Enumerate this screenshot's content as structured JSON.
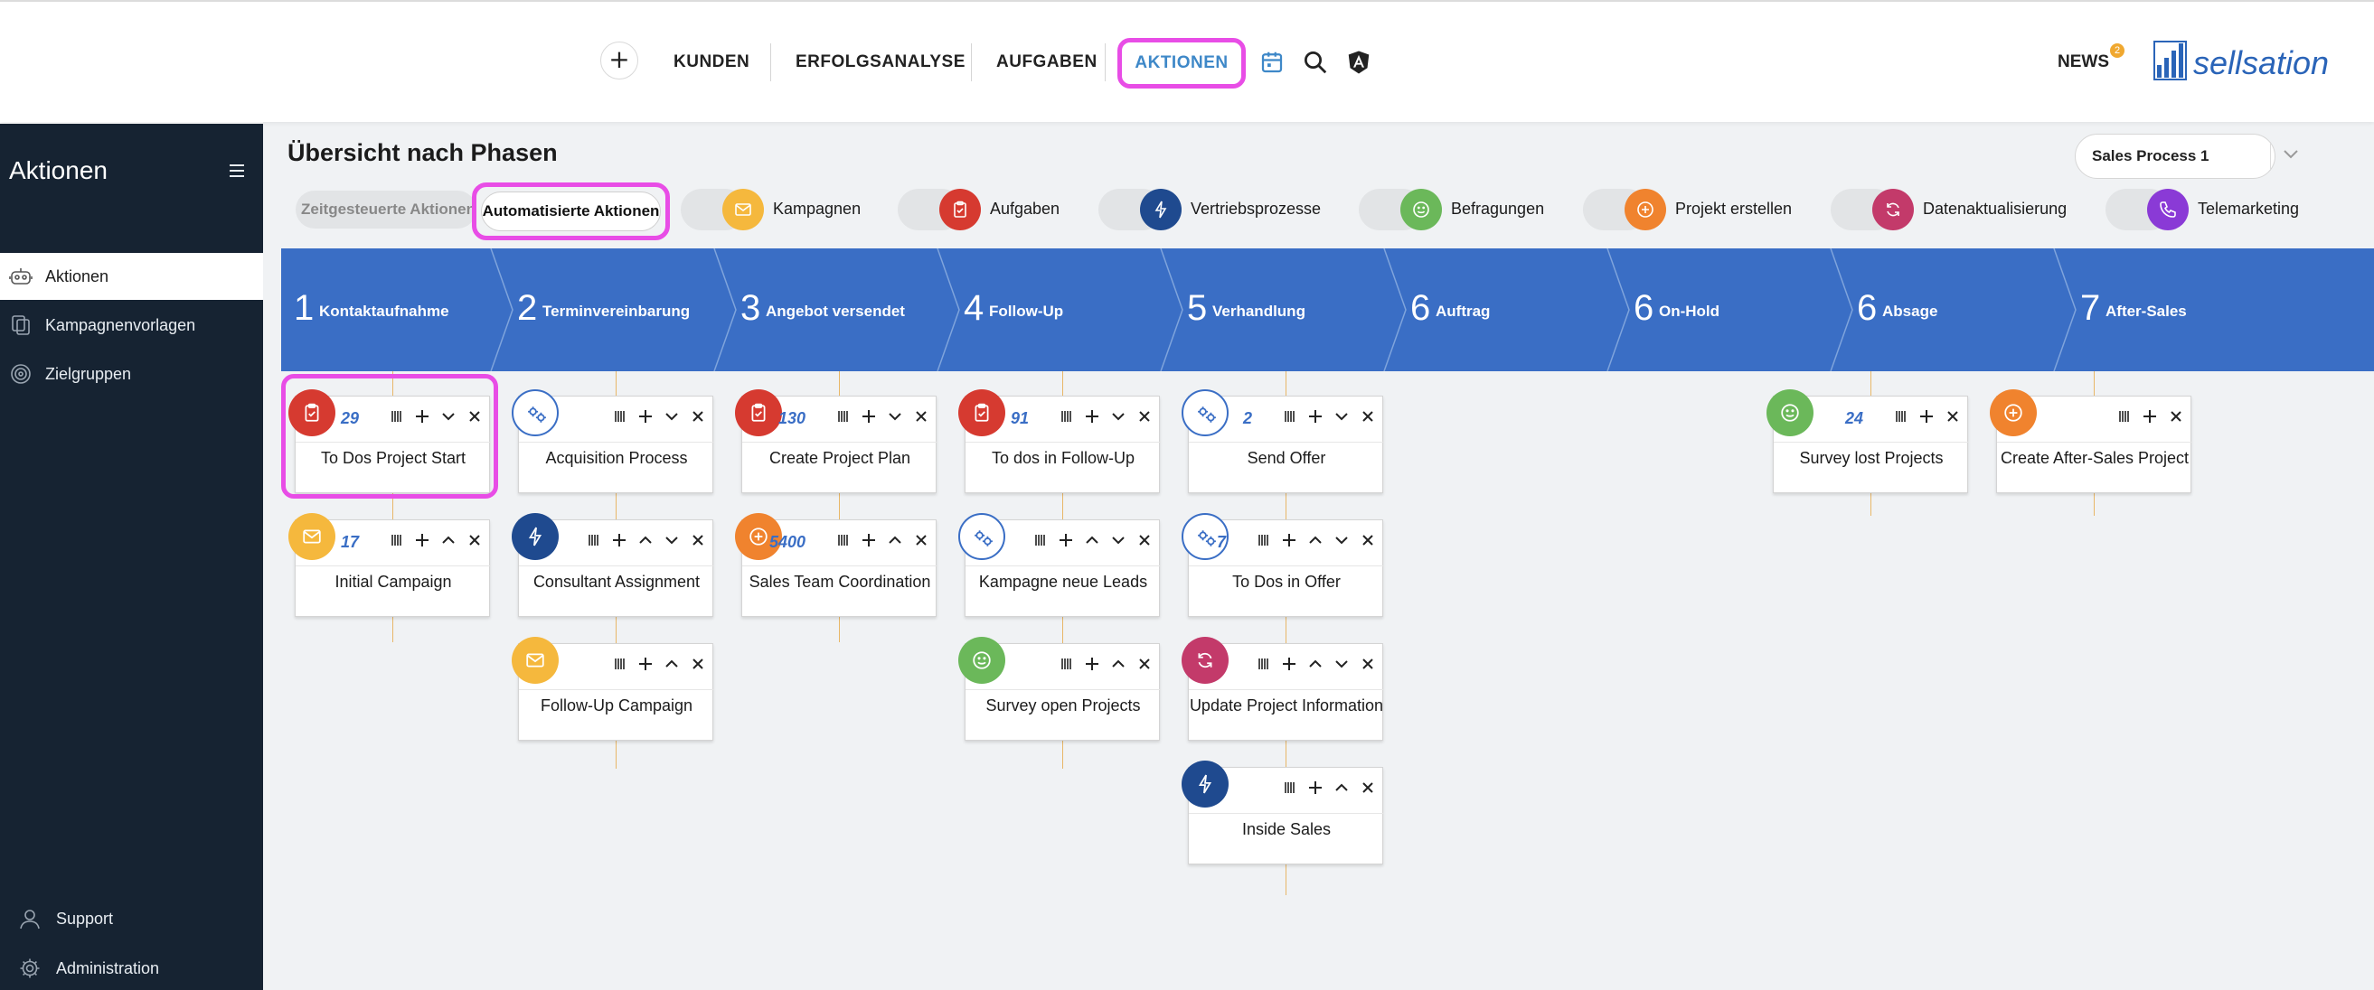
{
  "topbar": {
    "add_label": "+",
    "nav": [
      "KUNDEN",
      "ERFOLGSANALYSE",
      "AUFGABEN"
    ],
    "nav_active": "AKTIONEN",
    "news_label": "NEWS",
    "news_count": "2",
    "logo_text": "sellsation",
    "icons": [
      "calendar-icon",
      "search-icon",
      "angular-icon"
    ]
  },
  "sidebar": {
    "title": "Aktionen",
    "items": [
      {
        "label": "Aktionen",
        "icon": "robot-icon",
        "active": true
      },
      {
        "label": "Kampagnenvorlagen",
        "icon": "copy-icon",
        "active": false
      },
      {
        "label": "Zielgruppen",
        "icon": "target-icon",
        "active": false
      }
    ],
    "bottom": [
      {
        "label": "Support",
        "icon": "support-icon"
      },
      {
        "label": "Administration",
        "icon": "gear-icon"
      }
    ]
  },
  "main": {
    "title": "Übersicht nach Phasen",
    "process_select": "Sales Process 1",
    "filters": {
      "timed": "Zeitgesteuerte Aktionen",
      "automated": "Automatisierte Aktionen",
      "toggles": [
        {
          "label": "Kampagnen",
          "color": "#f5b83d",
          "icon": "mail-icon"
        },
        {
          "label": "Aufgaben",
          "color": "#d63a30",
          "icon": "clipboard-icon"
        },
        {
          "label": "Vertriebsprozesse",
          "color": "#1f4a8f",
          "icon": "bolt-icon"
        },
        {
          "label": "Befragungen",
          "color": "#6bb85a",
          "icon": "smiley-icon"
        },
        {
          "label": "Projekt erstellen",
          "color": "#f0832e",
          "icon": "plus-circle-icon"
        },
        {
          "label": "Datenaktualisierung",
          "color": "#c33a6a",
          "icon": "refresh-icon"
        },
        {
          "label": "Telemarketing",
          "color": "#8a3ad6",
          "icon": "phone-icon"
        }
      ]
    },
    "phases": [
      {
        "num": "1",
        "name": "Kontaktaufnahme"
      },
      {
        "num": "2",
        "name": "Terminvereinbarung"
      },
      {
        "num": "3",
        "name": "Angebot versendet"
      },
      {
        "num": "4",
        "name": "Follow-Up"
      },
      {
        "num": "5",
        "name": "Verhandlung"
      },
      {
        "num": "6",
        "name": "Auftrag"
      },
      {
        "num": "6",
        "name": "On-Hold"
      },
      {
        "num": "6",
        "name": "Absage"
      },
      {
        "num": "7",
        "name": "After-Sales"
      }
    ],
    "cards": [
      {
        "label": "To Dos Project Start",
        "count": "29",
        "type": "task"
      },
      {
        "label": "Initial Campaign",
        "count": "17",
        "type": "mail"
      },
      {
        "label": "Acquisition Process",
        "count": "",
        "type": "process"
      },
      {
        "label": "Consultant Assignment",
        "count": "",
        "type": "bolt"
      },
      {
        "label": "Follow-Up Campaign",
        "count": "",
        "type": "mail"
      },
      {
        "label": "Create Project Plan",
        "count": "130",
        "type": "task"
      },
      {
        "label": "Sales Team Coordination",
        "count": "5400",
        "type": "project"
      },
      {
        "label": "To dos in Follow-Up",
        "count": "91",
        "type": "task"
      },
      {
        "label": "Kampagne neue Leads",
        "count": "",
        "type": "process"
      },
      {
        "label": "Survey open Projects",
        "count": "",
        "type": "survey"
      },
      {
        "label": "Send Offer",
        "count": "2",
        "type": "process"
      },
      {
        "label": "To Dos in Offer",
        "count": "7",
        "type": "process"
      },
      {
        "label": "Update Project Information",
        "count": "",
        "type": "refresh"
      },
      {
        "label": "Inside Sales",
        "count": "",
        "type": "bolt"
      },
      {
        "label": "Survey lost Projects",
        "count": "24",
        "type": "survey"
      },
      {
        "label": "Create After-Sales Project",
        "count": "",
        "type": "project"
      }
    ]
  },
  "colors": {
    "sidebar_bg": "#162332",
    "band": "#3a6ec5",
    "highlight": "#e84de6",
    "count": "#3a6ec5"
  }
}
